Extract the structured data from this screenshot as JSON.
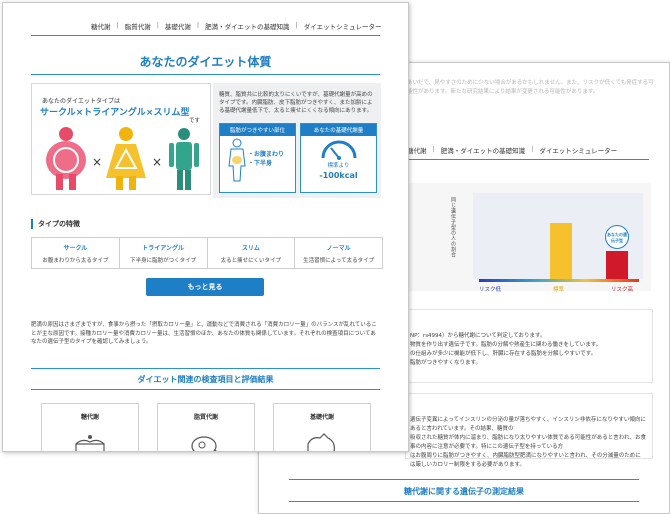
{
  "nav": {
    "items": [
      "糖代謝",
      "脂質代謝",
      "基礎代謝",
      "肥満・ダイエットの基礎知識",
      "ダイエットシミュレーター"
    ]
  },
  "front": {
    "title": "あなたのダイエット体質",
    "type_card": {
      "caption": "あなたのダイエットタイプは",
      "result": "サークル×トライアングル×スリム型",
      "suffix": "です"
    },
    "info": {
      "paragraph": "糖質、脂質共に比較的太りにくいですが、基礎代謝量が高めのタイプです。内臓脂肪、皮下脂肪がつきやすく、また加齢による基礎代謝量低下で、太ると痩せにくくなる傾向にあります。",
      "fat_card": {
        "header": "脂肪がつきやすい部位",
        "line1": "・お腹まわり",
        "line2": "・下半身"
      },
      "bmr_card": {
        "header": "あなたの基礎代謝量",
        "line1": "標準より",
        "value": "-100kcal"
      }
    },
    "features_heading": "タイプの特徴",
    "features": [
      {
        "name": "サークル",
        "desc": "お腹まわりから太るタイプ"
      },
      {
        "name": "トライアングル",
        "desc": "下半身に脂肪がつくタイプ"
      },
      {
        "name": "スリム",
        "desc": "太ると痩せにくいタイプ"
      },
      {
        "name": "ノーマル",
        "desc": "生活習慣によって太るタイプ"
      }
    ],
    "more_button": "もっと見る",
    "body_text": "肥満の原因はさまざまですが、食事から摂った「摂取カロリー量」と、運動などで消費される「消費カロリー量」のバランスが乱れていることが主な原因です。接種カロリー量や消費カロリー量は、生活習慣のほか、あなたの体質も関係しています。それぞれの検査項目についてあなたの遺伝子型のタイプを確認してみましょう。",
    "results_heading": "ダイエット関連の検査項目と評価結果",
    "categories": [
      "糖代謝",
      "脂質代謝",
      "基礎代謝"
    ]
  },
  "back": {
    "faint_text": "あいだで、見やすさのために少ない場合があるかもしれません。また、リスクが低くても発症する可能性があります。新たな研究結果により結果が変更される可能性があります。",
    "nav_items": [
      "糖代謝",
      "肥満・ダイエットの基礎知識",
      "ダイエットシミュレーター"
    ],
    "heading_fragment": "臓\n脂が",
    "chart_ylabel": "同じ遺伝子型の人の割合",
    "bubble": "あなたの遺伝子型",
    "risk_labels": {
      "low": "リスク低",
      "mid": "標準",
      "high": "リスク高"
    },
    "text1": "NP：rs4994）から糖代謝について判定しております。\n物質を作り出す遺伝子です。脂肪の分解や熱産生に関わる働きをしています。\nの仕組みが多少に機能が低下し、肝臓に存在する脂肪を分解しやすいです。\n脂肪がつきやすくなります。",
    "text2": "遺伝子変異によってインスリンの分泌の量が落ちやすく、インスリン非依存になりやすい傾向にあると言われています。その結果、糖質の\n吸収された糖質が体内に溜まり、脂肪になり太りやすい体質である可能性があると言われ、お食事の内容に注意が必要です。特にこの遺伝子型を持っている方\nはお腹周りに脂肪がつきやすく、内臓脂肪型肥満になりやすいと言われ、その分減量のためには厳しいカロリー制限をする必要があります。",
    "section_heading": "糖代謝に関する遺伝子の測定結果"
  },
  "chart_data": {
    "type": "bar",
    "categories": [
      "リスク低",
      "標準",
      "リスク高"
    ],
    "values": [
      0,
      65,
      32
    ],
    "ylabel": "同じ遺伝子型の人の割合",
    "colors": [
      "#2a3bb5",
      "#f5c22d",
      "#d0192a"
    ],
    "highlight": "リスク高"
  }
}
